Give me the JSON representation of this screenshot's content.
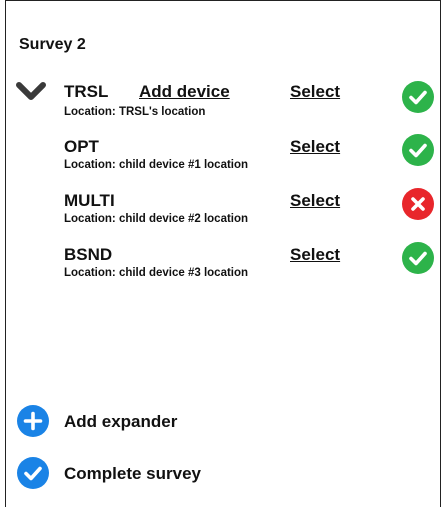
{
  "survey": {
    "title": "Survey 2"
  },
  "parent_device": {
    "name": "TRSL",
    "add_device_label": "Add device",
    "location": "Location: TRSL's location",
    "select_label": "Select",
    "status": "ok"
  },
  "devices": [
    {
      "name": "OPT",
      "location": "Location: child device #1 location",
      "select_label": "Select",
      "status": "ok"
    },
    {
      "name": "MULTI",
      "location": "Location: child device #2 location",
      "select_label": "Select",
      "status": "error"
    },
    {
      "name": "BSND",
      "location": "Location: child device #3 location",
      "select_label": "Select",
      "status": "ok"
    }
  ],
  "actions": {
    "add_expander_label": "Add expander",
    "complete_survey_label": "Complete survey"
  },
  "colors": {
    "ok": "#2db34a",
    "error": "#e8262b",
    "action": "#1a83e6",
    "chevron": "#3a3a3a"
  }
}
